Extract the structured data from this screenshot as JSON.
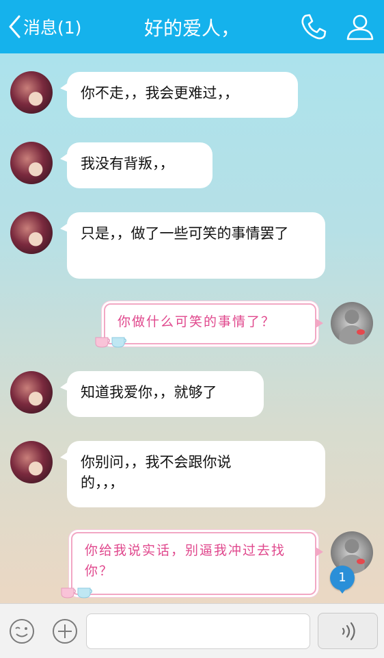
{
  "header": {
    "back_label": "消息(1)",
    "title": "好的爱人，"
  },
  "messages": [
    {
      "side": "left",
      "text": "你不走，，我会更难过，，"
    },
    {
      "side": "left",
      "text": "我没有背叛，，"
    },
    {
      "side": "left",
      "text": "只是，，做了一些可笑的事情罢了"
    },
    {
      "side": "right",
      "text": "你做什么可笑的事情了？"
    },
    {
      "side": "left",
      "text": "知道我爱你，，就够了"
    },
    {
      "side": "left",
      "text": "你别问，，我不会跟你说的，，，"
    },
    {
      "side": "right",
      "text": "你给我说实话，别逼我冲过去找你？"
    }
  ],
  "unread_badge": "1",
  "colors": {
    "header": "#15b2ec",
    "pink_text": "#e0488d",
    "pink_border": "#f2a7c4",
    "badge": "#2a8fd8"
  },
  "icons": [
    "chevron-left-icon",
    "phone-icon",
    "user-icon",
    "emoji-icon",
    "plus-icon",
    "voice-icon"
  ]
}
